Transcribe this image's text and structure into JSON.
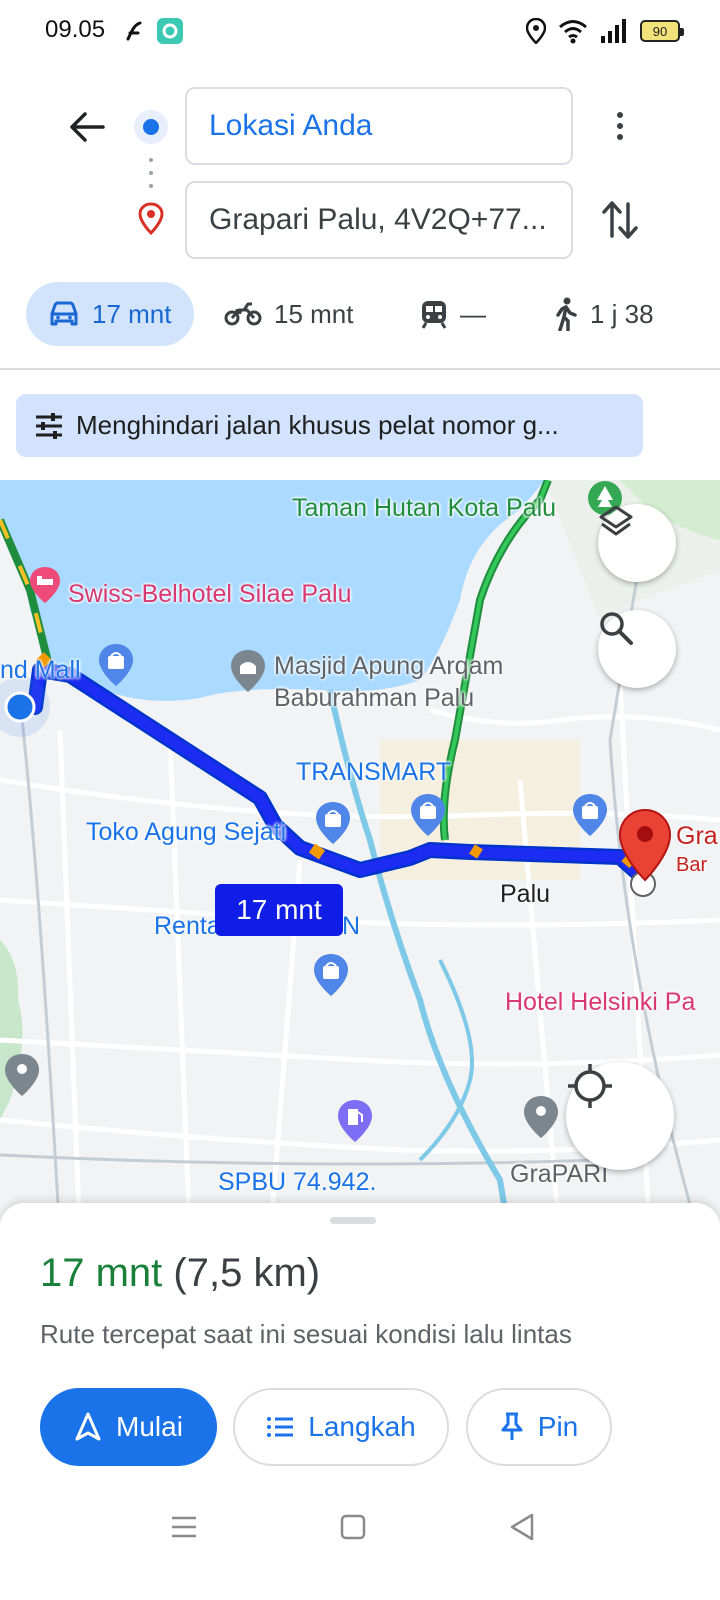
{
  "status_bar": {
    "time": "09.05",
    "battery": "90"
  },
  "header": {
    "origin": "Lokasi Anda",
    "destination": "Grapari Palu, 4V2Q+77..."
  },
  "modes": [
    {
      "label": "17 mnt",
      "icon": "car-icon",
      "active": true
    },
    {
      "label": "15 mnt",
      "icon": "motorcycle-icon",
      "active": false
    },
    {
      "label": "—",
      "icon": "train-icon",
      "active": false
    },
    {
      "label": "1 j 38",
      "icon": "walking-icon",
      "active": false
    }
  ],
  "avoid_chip": "Menghindari jalan khusus pelat nomor g...",
  "map": {
    "labels": {
      "taman_hutan": "Taman Hutan Kota Palu",
      "swiss_belhotel": "Swiss-Belhotel Silae Palu",
      "mall": "nd Mall",
      "masjid": "Masjid Apung Arqam\nBaburahman Palu",
      "transmart": "TRANSMART",
      "toko_agung": "Toko Agung Sejati",
      "renta": "Renta",
      "renta_n": "N",
      "palu": "Palu",
      "hotel_helsinki": "Hotel Helsinki Pa",
      "spbu": "SPBU 74.942.",
      "grapari_map": "GraPARI",
      "gra_dest": "Gra",
      "bar": "Bar"
    },
    "route_time": "17 mnt"
  },
  "summary": {
    "time": "17 mnt",
    "distance": "(7,5 km)",
    "description": "Rute tercepat saat ini sesuai kondisi lalu lintas"
  },
  "buttons": {
    "start": "Mulai",
    "steps": "Langkah",
    "pin": "Pin"
  }
}
